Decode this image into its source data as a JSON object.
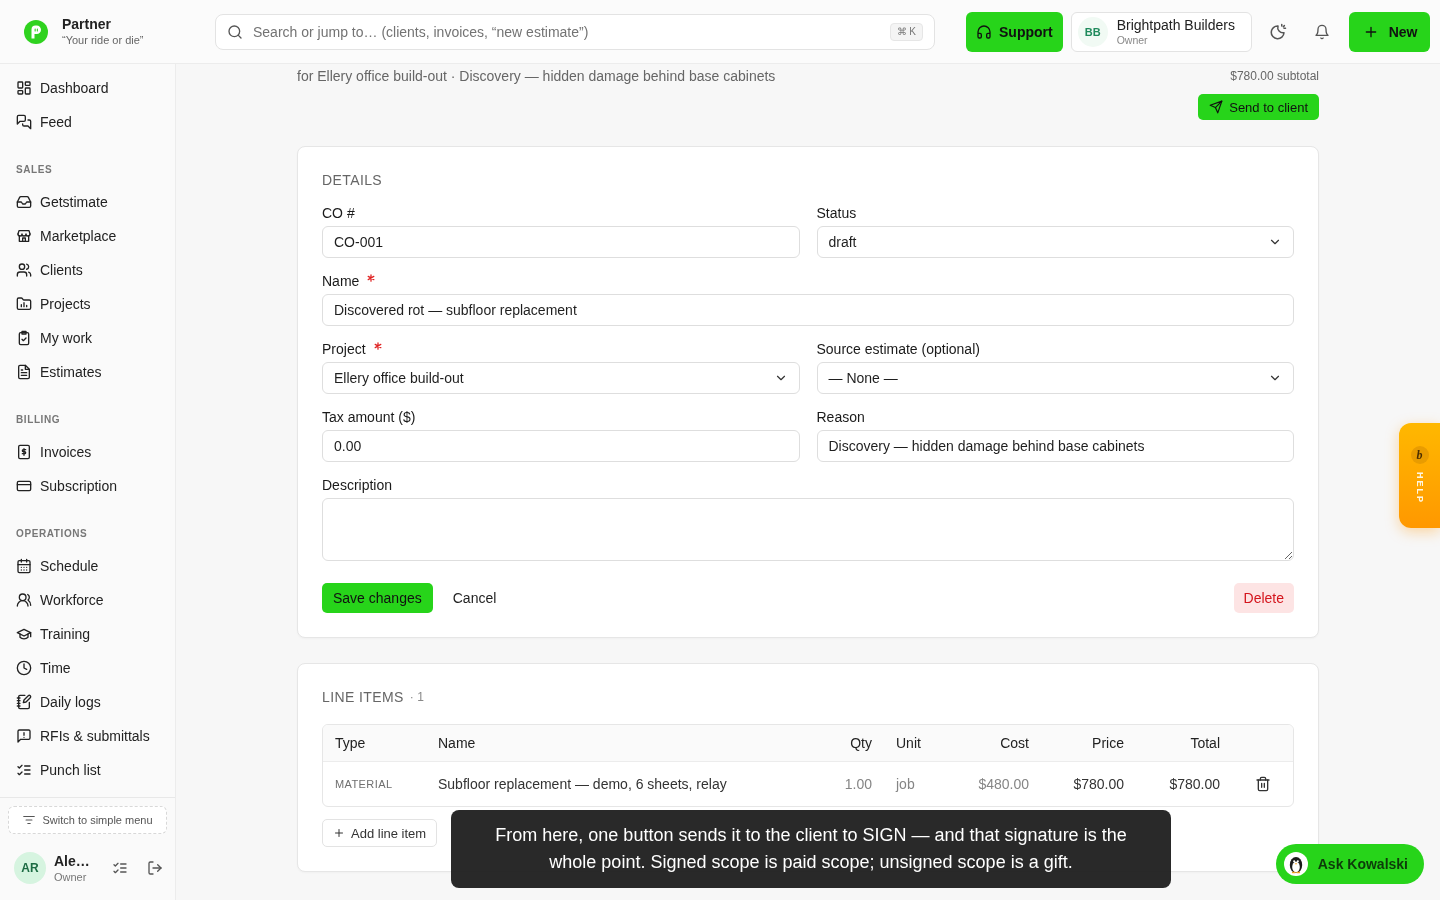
{
  "header": {
    "brand": {
      "name": "Partner",
      "tagline": "“Your ride or die”"
    },
    "search": {
      "placeholder": "Search or jump to… (clients, invoices, “new estimate”)",
      "shortcut": "⌘ K"
    },
    "support_button": "Support",
    "company": {
      "initials": "BB",
      "name": "Brightpath Builders",
      "role": "Owner"
    },
    "new_button": "New"
  },
  "sidebar": {
    "sections": [
      {
        "items": [
          {
            "label": "Dashboard",
            "selected": false
          },
          {
            "label": "Feed",
            "selected": false
          }
        ]
      },
      {
        "title": "SALES",
        "items": [
          {
            "label": "Getstimate",
            "selected": false
          },
          {
            "label": "Marketplace",
            "selected": false
          },
          {
            "label": "Clients",
            "selected": false
          },
          {
            "label": "Projects",
            "selected": false
          },
          {
            "label": "My work",
            "selected": false
          },
          {
            "label": "Estimates",
            "selected": false
          }
        ]
      },
      {
        "title": "BILLING",
        "items": [
          {
            "label": "Invoices",
            "selected": false
          },
          {
            "label": "Subscription",
            "selected": false
          }
        ]
      },
      {
        "title": "OPERATIONS",
        "items": [
          {
            "label": "Schedule",
            "selected": false
          },
          {
            "label": "Workforce",
            "selected": false
          },
          {
            "label": "Training",
            "selected": false
          },
          {
            "label": "Time",
            "selected": false
          },
          {
            "label": "Daily logs",
            "selected": false
          },
          {
            "label": "RFIs & submittals",
            "selected": false
          },
          {
            "label": "Punch list",
            "selected": false
          }
        ]
      }
    ],
    "switch_button": "Switch to simple menu",
    "user": {
      "initials": "AR",
      "name": "Ale…",
      "role": "Owner"
    }
  },
  "page": {
    "subtitle": "for Ellery office build-out · Discovery — hidden damage behind base cabinets",
    "subtotal": "$780.00 subtotal",
    "send_button": "Send to client"
  },
  "details": {
    "title": "DETAILS",
    "rows": [
      [
        {
          "label": "CO #",
          "kind": "text",
          "value": "CO-001",
          "required": false
        },
        {
          "label": "Status",
          "kind": "select",
          "value": "draft",
          "required": false
        }
      ],
      [
        {
          "label": "Name",
          "kind": "text",
          "value": "Discovered rot — subfloor replacement",
          "required": true
        }
      ],
      [
        {
          "label": "Project",
          "kind": "select",
          "value": "Ellery office build-out",
          "required": true
        },
        {
          "label": "Source estimate (optional)",
          "kind": "select",
          "value": "— None —",
          "required": false
        }
      ],
      [
        {
          "label": "Tax amount ($)",
          "kind": "text",
          "value": "0.00",
          "required": false
        },
        {
          "label": "Reason",
          "kind": "text",
          "value": "Discovery — hidden damage behind base cabinets",
          "required": false
        }
      ],
      [
        {
          "label": "Description",
          "kind": "textarea",
          "required": false
        }
      ]
    ],
    "actions": {
      "save": "Save changes",
      "cancel": "Cancel",
      "delete": "Delete"
    }
  },
  "line_items": {
    "title": "LINE ITEMS",
    "count": "· 1",
    "columns": [
      "Type",
      "Name",
      "Qty",
      "Unit",
      "Cost",
      "Price",
      "Total"
    ],
    "rows": [
      {
        "type": "MATERIAL",
        "name": "Subfloor replacement — demo, 6 sheets, relay",
        "qty": "1.00",
        "unit": "job",
        "cost": "$480.00",
        "price": "$780.00",
        "total": "$780.00"
      }
    ],
    "add_button": "Add line item"
  },
  "tour_tooltip": "From here, one button sends it to the client to SIGN — and that signature is the whole point. Signed scope is paid scope; unsigned scope is a gift.",
  "help_tab": {
    "badge": "b",
    "label": "HELP"
  },
  "assistant_button": "Ask Kowalski"
}
